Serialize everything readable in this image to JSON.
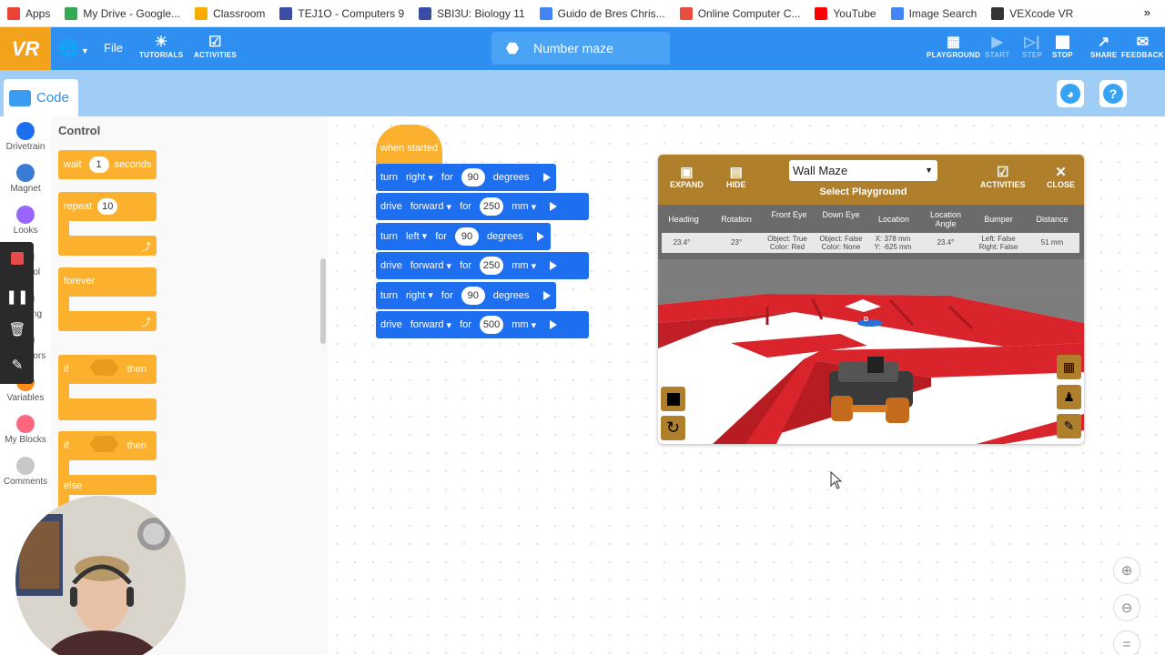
{
  "bookmarks": [
    {
      "label": "Apps",
      "color": "#ea4335"
    },
    {
      "label": "My Drive - Google...",
      "color": "#34a853"
    },
    {
      "label": "Classroom",
      "color": "#f9ab00"
    },
    {
      "label": "TEJ1O - Computers 9",
      "color": "#3c4ba6"
    },
    {
      "label": "SBI3U: Biology 11",
      "color": "#3c4ba6"
    },
    {
      "label": "Guido de Bres Chris...",
      "color": "#4285f4"
    },
    {
      "label": "Online Computer C...",
      "color": "#e74c3c"
    },
    {
      "label": "YouTube",
      "color": "#ff0000"
    },
    {
      "label": "Image Search",
      "color": "#4285f4"
    },
    {
      "label": "VEXcode VR",
      "color": "#333333"
    }
  ],
  "bookmarks_more": "»",
  "topbar": {
    "logo": "VR",
    "file_label": "File",
    "tutorials_label": "TUTORIALS",
    "activities_label": "ACTIVITIES",
    "project_name": "Number maze",
    "playground_label": "PLAYGROUND",
    "start_label": "START",
    "step_label": "STEP",
    "stop_label": "STOP",
    "share_label": "SHARE",
    "feedback_label": "FEEDBACK"
  },
  "codebar": {
    "code_tab": "Code",
    "help_glyph": "?"
  },
  "categories": [
    {
      "label": "Drivetrain",
      "color": "#1e6ef0"
    },
    {
      "label": "Magnet",
      "color": "#3a7bd5"
    },
    {
      "label": "Looks",
      "color": "#9966ff"
    },
    {
      "label": "Control",
      "color": "#fbb12d"
    },
    {
      "label": "Sensing",
      "color": "#5cb1d6"
    },
    {
      "label": "Operators",
      "color": "#59c059"
    },
    {
      "label": "Variables",
      "color": "#ff8c1a"
    },
    {
      "label": "My Blocks",
      "color": "#ff6680"
    },
    {
      "label": "Comments",
      "color": "#c8c8c8"
    }
  ],
  "flyout": {
    "title": "Control",
    "wait": {
      "label": "wait",
      "value": "1",
      "unit": "seconds"
    },
    "repeat": {
      "label": "repeat",
      "value": "10"
    },
    "forever": {
      "label": "forever"
    },
    "if_then": {
      "if": "if",
      "then": "then"
    },
    "if_else": {
      "if": "if",
      "then": "then",
      "else": "else"
    }
  },
  "program": {
    "hat": "when started",
    "blocks": [
      {
        "cmd": "turn",
        "dir": "right",
        "for": "for",
        "value": "90",
        "unit": "degrees",
        "unit_dd": false
      },
      {
        "cmd": "drive",
        "dir": "forward",
        "for": "for",
        "value": "250",
        "unit": "mm",
        "unit_dd": true
      },
      {
        "cmd": "turn",
        "dir": "left",
        "for": "for",
        "value": "90",
        "unit": "degrees",
        "unit_dd": false
      },
      {
        "cmd": "drive",
        "dir": "forward",
        "for": "for",
        "value": "250",
        "unit": "mm",
        "unit_dd": true
      },
      {
        "cmd": "turn",
        "dir": "right",
        "for": "for",
        "value": "90",
        "unit": "degrees",
        "unit_dd": false
      },
      {
        "cmd": "drive",
        "dir": "forward",
        "for": "for",
        "value": "500",
        "unit": "mm",
        "unit_dd": true
      }
    ]
  },
  "playground": {
    "expand_label": "EXPAND",
    "hide_label": "HIDE",
    "selected": "Wall Maze",
    "select_caption": "Select Playground",
    "activities_label": "ACTIVITIES",
    "close_label": "CLOSE",
    "headers": [
      "Heading",
      "Rotation",
      "Front Eye",
      "Down Eye",
      "Location",
      "Location Angle",
      "Bumper",
      "Distance"
    ],
    "values": {
      "heading": "23.4°",
      "rotation": "23°",
      "front_eye_1": "Object: True",
      "front_eye_2": "Color: Red",
      "down_eye_1": "Object: False",
      "down_eye_2": "Color: None",
      "location_1": "X: 378 mm",
      "location_2": "Y: -625 mm",
      "location_angle": "23.4°",
      "bumper_1": "Left: False",
      "bumper_2": "Right: False",
      "distance": "51 mm"
    },
    "maze_marker": "D"
  },
  "colors": {
    "topbar": "#2f8ff0",
    "drivetrain_block": "#1e6ef0",
    "control_block": "#fbb12d",
    "playground_header": "#b07f2c",
    "maze_wall": "#d8242a"
  }
}
